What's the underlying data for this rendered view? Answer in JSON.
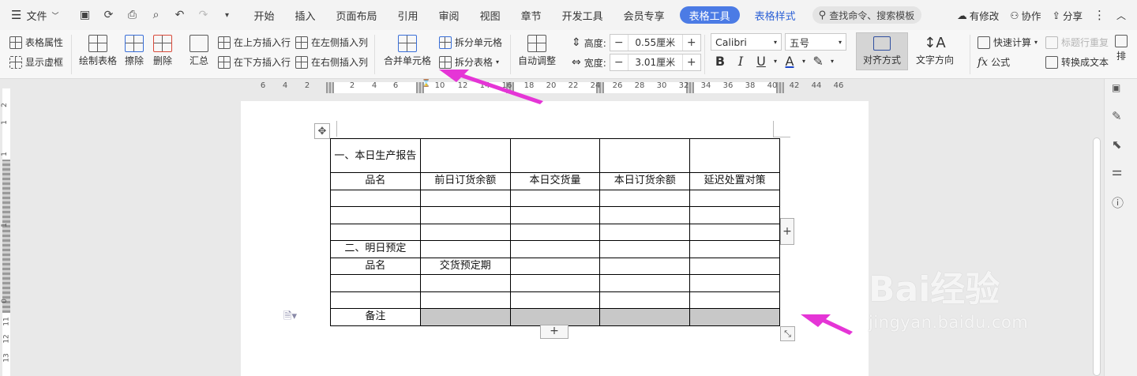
{
  "menubar": {
    "file_label": "文件",
    "tabs": [
      "开始",
      "插入",
      "页面布局",
      "引用",
      "审阅",
      "视图",
      "章节",
      "开发工具",
      "会员专享"
    ],
    "active_tab": "表格工具",
    "style_tab": "表格样式",
    "search_placeholder": "查找命令、搜索模板",
    "modified_label": "有修改",
    "collab_label": "协作",
    "share_label": "分享"
  },
  "ribbon": {
    "table_props": "表格属性",
    "show_grid": "显示虚框",
    "draw_table": "绘制表格",
    "erase": "擦除",
    "delete": "删除",
    "summary": "汇总",
    "insert_above": "在上方插入行",
    "insert_below": "在下方插入行",
    "insert_left": "在左侧插入列",
    "insert_right": "在右侧插入列",
    "merge_cells": "合并单元格",
    "split_cells": "拆分单元格",
    "split_table": "拆分表格",
    "auto_adjust": "自动调整",
    "height_label": "高度:",
    "height_value": "0.55厘米",
    "width_label": "宽度:",
    "width_value": "3.01厘米",
    "font_name": "Calibri",
    "font_size": "五号",
    "align": "对齐方式",
    "text_dir": "文字方向",
    "quick_calc": "快速计算",
    "formula": "公式",
    "header_repeat": "标题行重复",
    "to_text": "转换成文本",
    "sort_partial": "排"
  },
  "ruler": {
    "h_ticks": [
      "6",
      "4",
      "2",
      "2",
      "4",
      "6",
      "10",
      "12",
      "14",
      "16",
      "18",
      "20",
      "22",
      "24",
      "26",
      "28",
      "30",
      "32",
      "34",
      "36",
      "38",
      "40",
      "42",
      "44",
      "46"
    ],
    "v_ticks": [
      "2",
      "1",
      "1",
      "1",
      "0",
      "11",
      "12",
      "13"
    ]
  },
  "table": {
    "title1": "一、本日生产报告",
    "headers1": [
      "品名",
      "前日订货余额",
      "本日交货量",
      "本日订货余额",
      "延迟处置对策"
    ],
    "title2": "二、明日预定",
    "headers2": [
      "品名",
      "交货预定期"
    ],
    "notes": "备注"
  },
  "watermark": {
    "brand": "Bai经验",
    "url": "jingyan.baidu.com"
  },
  "colors": {
    "accent": "#4b7be5",
    "annotation_arrow": "#e535d6",
    "gray_cell": "#c8c8c8"
  }
}
